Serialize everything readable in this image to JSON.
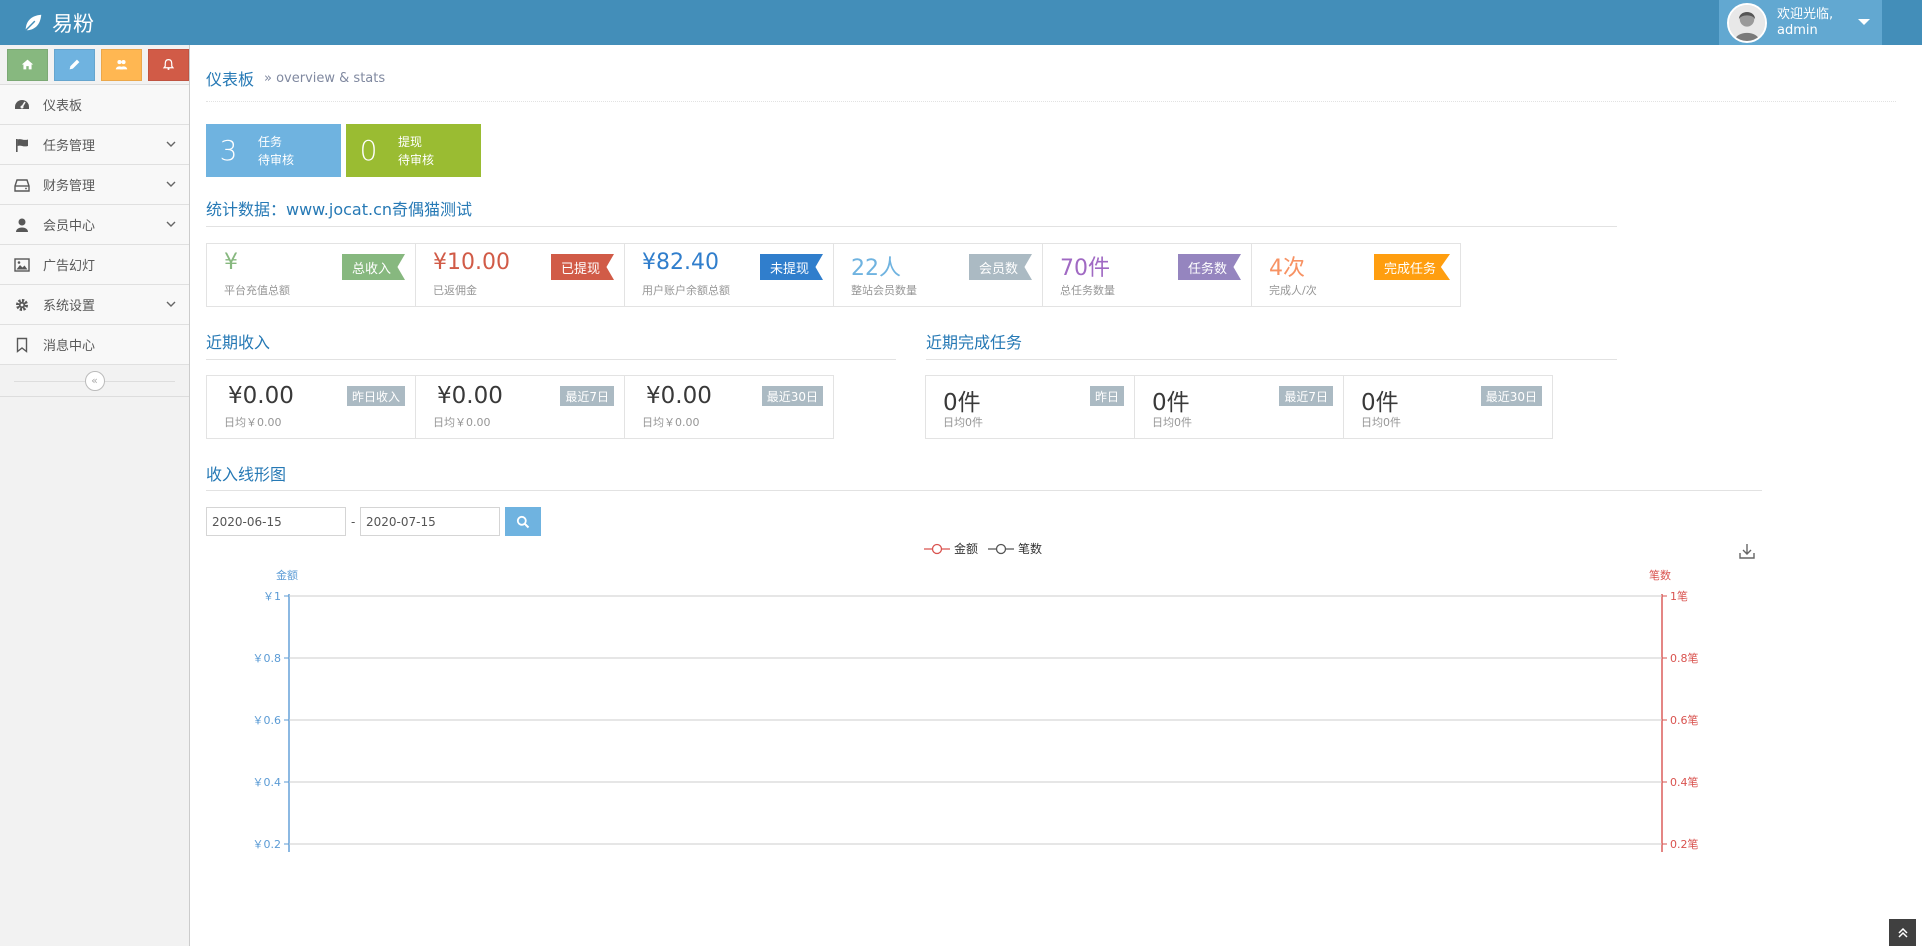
{
  "app": {
    "name": "易粉"
  },
  "user": {
    "greeting": "欢迎光临,",
    "name": "admin"
  },
  "sidebar": {
    "items": [
      {
        "label": "仪表板",
        "icon": "dashboard-icon",
        "has_children": false
      },
      {
        "label": "任务管理",
        "icon": "flag-icon",
        "has_children": true
      },
      {
        "label": "财务管理",
        "icon": "hdd-icon",
        "has_children": true
      },
      {
        "label": "会员中心",
        "icon": "user-icon",
        "has_children": true
      },
      {
        "label": "广告幻灯",
        "icon": "picture-icon",
        "has_children": false
      },
      {
        "label": "系统设置",
        "icon": "cog-icon",
        "has_children": true
      },
      {
        "label": "消息中心",
        "icon": "bookmark-icon",
        "has_children": false
      }
    ]
  },
  "breadcrumb": {
    "title": "仪表板",
    "sub": "» overview & stats"
  },
  "pending": [
    {
      "count": "3",
      "line1": "任务",
      "line2": "待审核",
      "color": "#6fb3e0"
    },
    {
      "count": "0",
      "line1": "提现",
      "line2": "待审核",
      "color": "#9abc32"
    }
  ],
  "stats_title": "统计数据：www.jocat.cn奇偶猫测试",
  "stats": [
    {
      "value": "¥",
      "label": "平台充值总额",
      "tag": "总收入",
      "value_color": "#87b87f",
      "tag_color": "#87b87f"
    },
    {
      "value": "¥10.00",
      "label": "已返佣金",
      "tag": "已提现",
      "value_color": "#d15b47",
      "tag_color": "#d15b47"
    },
    {
      "value": "¥82.40",
      "label": "用户账户余额总额",
      "tag": "未提现",
      "value_color": "#307ecc",
      "tag_color": "#307ecc"
    },
    {
      "value": "22人",
      "label": "整站会员数量",
      "tag": "会员数",
      "value_color": "#6fb3e0",
      "tag_color": "#abbac3"
    },
    {
      "value": "70件",
      "label": "总任务数量",
      "tag": "任务数",
      "value_color": "#a069c3",
      "tag_color": "#9585bf"
    },
    {
      "value": "4次",
      "label": "完成人/次",
      "tag": "完成任务",
      "value_color": "#f79263",
      "tag_color": "#ff9e0f"
    }
  ],
  "income": {
    "title": "近期收入",
    "items": [
      {
        "value": "¥0.00",
        "tag": "昨日收入",
        "avg": "日均￥0.00"
      },
      {
        "value": "¥0.00",
        "tag": "最近7日",
        "avg": "日均￥0.00"
      },
      {
        "value": "¥0.00",
        "tag": "最近30日",
        "avg": "日均￥0.00"
      }
    ]
  },
  "tasks": {
    "title": "近期完成任务",
    "items": [
      {
        "value": "0件",
        "tag": "昨日",
        "avg": "日均0件"
      },
      {
        "value": "0件",
        "tag": "最近7日",
        "avg": "日均0件"
      },
      {
        "value": "0件",
        "tag": "最近30日",
        "avg": "日均0件"
      }
    ]
  },
  "chart_section": {
    "title": "收入线形图",
    "date_from": "2020-06-15",
    "date_to": "2020-07-15",
    "separator": "-"
  },
  "chart_data": {
    "type": "line",
    "legend": [
      "金额",
      "笔数"
    ],
    "legend_position": "top-center",
    "left_axis": {
      "label": "金额",
      "ticks": [
        "￥1",
        "￥0.8",
        "￥0.6",
        "￥0.4",
        "￥0.2"
      ],
      "color": "#5b9bd5"
    },
    "right_axis": {
      "label": "笔数",
      "ticks": [
        "1笔",
        "0.8笔",
        "0.6笔",
        "0.4笔",
        "0.2笔"
      ],
      "color": "#d9534f"
    },
    "ylim": [
      0,
      1
    ],
    "grid": true,
    "series": [
      {
        "name": "金额",
        "values": [],
        "color": "#d9534f"
      },
      {
        "name": "笔数",
        "values": [],
        "color": "#555555"
      }
    ]
  }
}
